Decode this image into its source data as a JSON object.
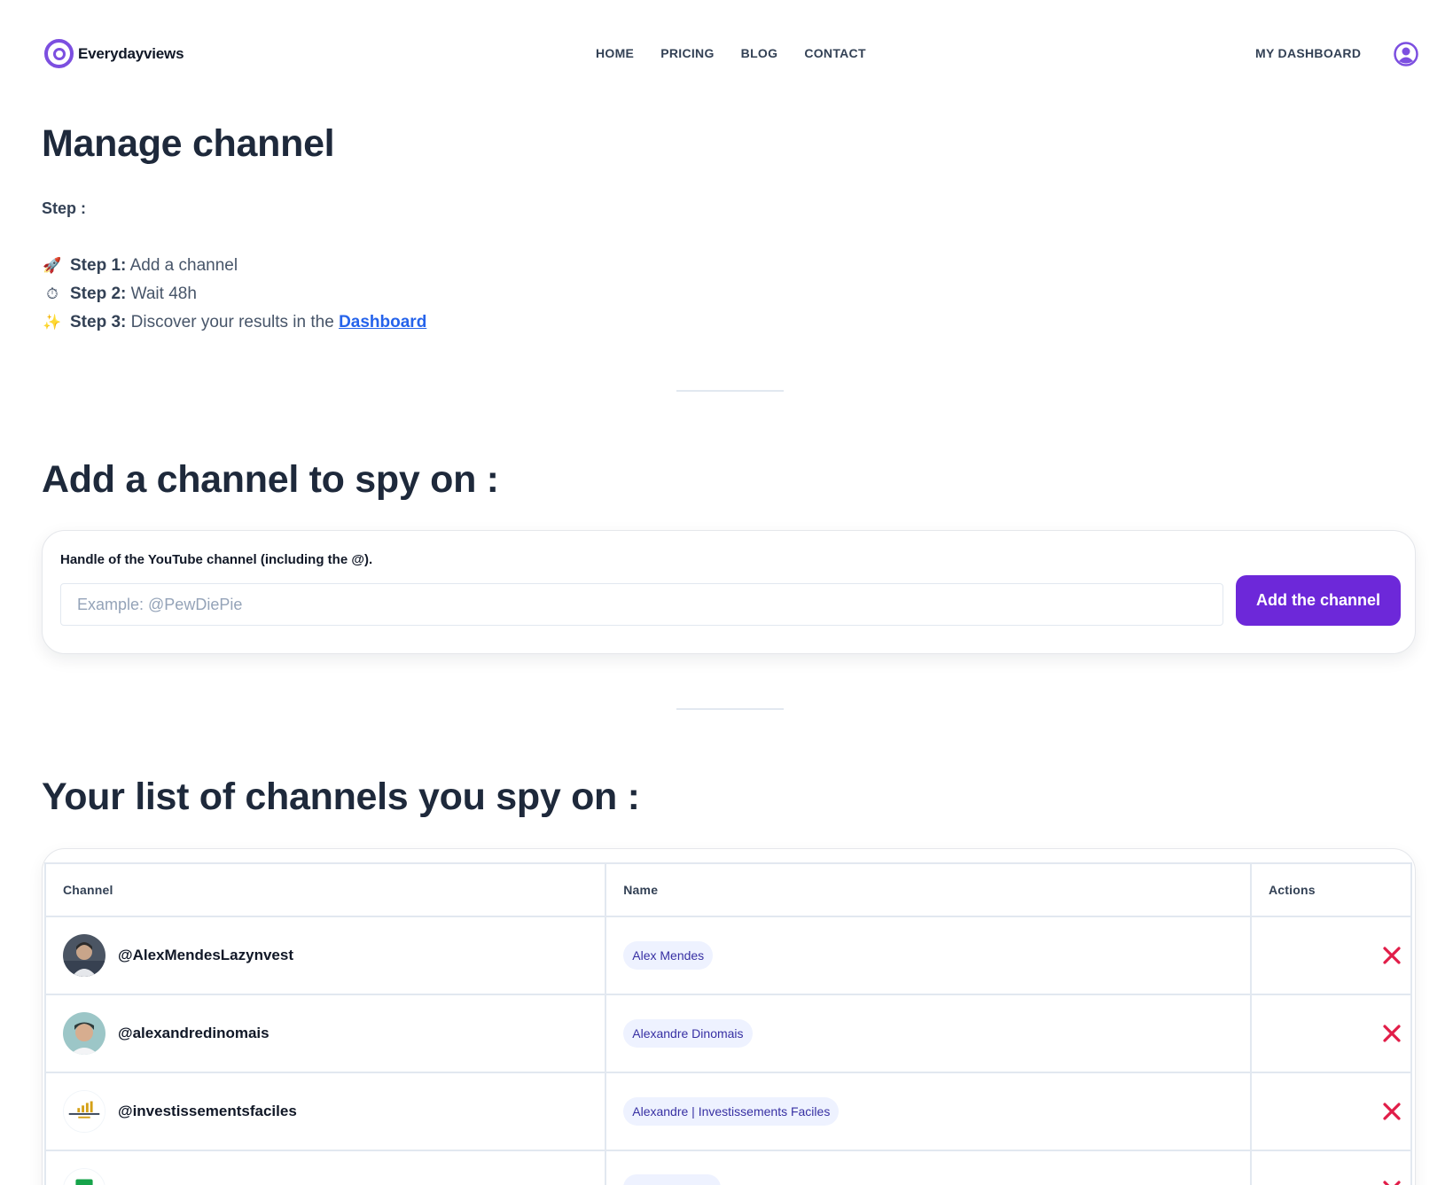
{
  "nav": {
    "brand": "Everydayviews",
    "links": [
      "HOME",
      "PRICING",
      "BLOG",
      "CONTACT"
    ],
    "dashboard": "MY DASHBOARD",
    "accent_color": "#7c4fe0"
  },
  "manage": {
    "title": "Manage channel",
    "step_heading": "Step :",
    "steps": [
      {
        "icon": "🚀",
        "label": "Step 1:",
        "text": "Add a channel"
      },
      {
        "icon": "⏱",
        "label": "Step 2:",
        "text": "Wait 48h"
      },
      {
        "icon": "✨",
        "label": "Step 3:",
        "text": "Discover your results in the ",
        "link": "Dashboard"
      }
    ]
  },
  "add": {
    "title": "Add a channel to spy on :",
    "label": "Handle of the YouTube channel (including the @).",
    "placeholder": "Example: @PewDiePie",
    "value": "",
    "button": "Add the channel",
    "button_color": "#6d28d9"
  },
  "list": {
    "title": "Your list of channels you spy on :",
    "columns": [
      "Channel",
      "Name",
      "Actions"
    ],
    "rows": [
      {
        "handle": "@AlexMendesLazynvest",
        "name": "Alex Mendes"
      },
      {
        "handle": "@alexandredinomais",
        "name": "Alexandre Dinomais"
      },
      {
        "handle": "@investissementsfaciles",
        "name": "Alexandre | Investissements Faciles"
      },
      {
        "handle": "",
        "name": ""
      }
    ],
    "delete_color": "#e11d48"
  }
}
